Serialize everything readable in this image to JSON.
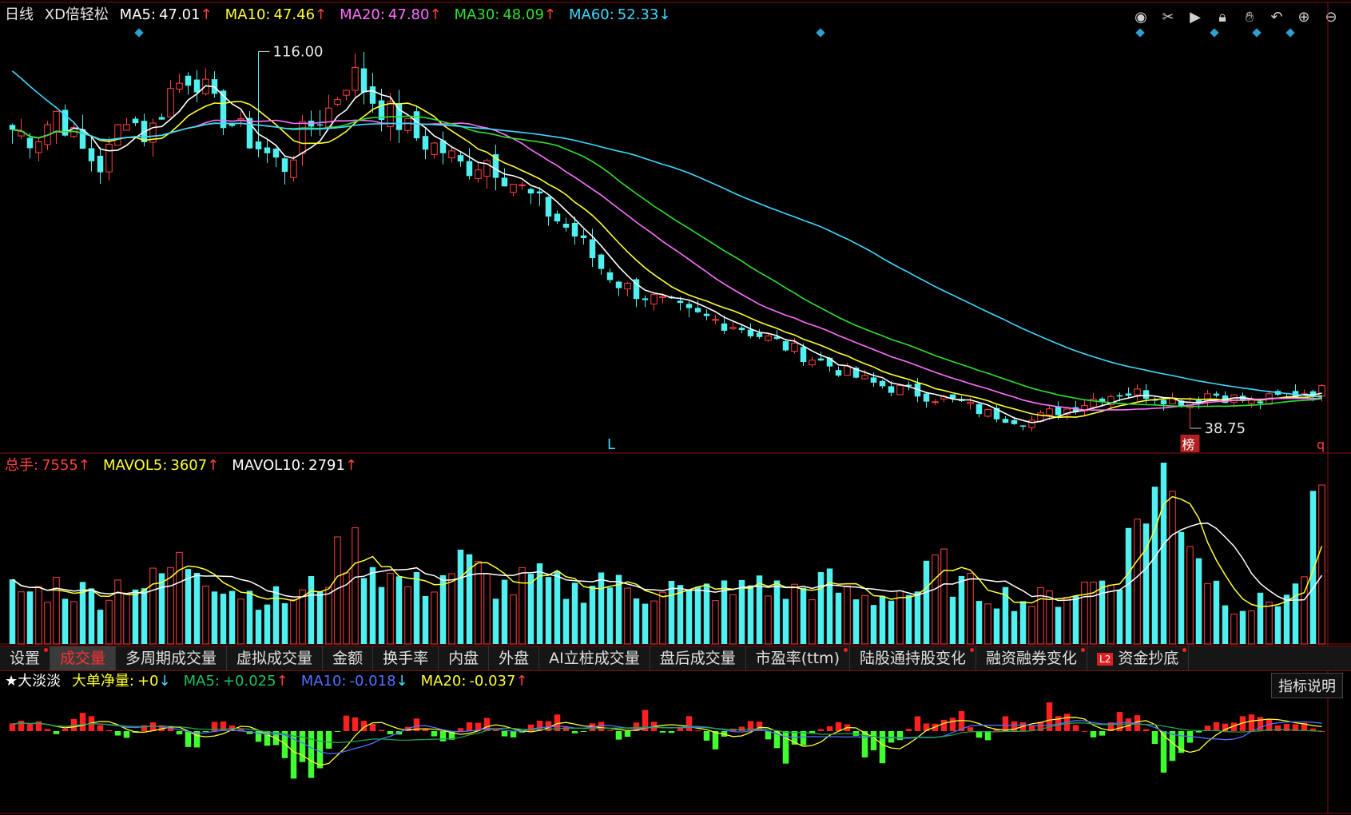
{
  "header": {
    "period": "日线",
    "stock": "XD倍轻松",
    "ma": [
      {
        "label": "MA5:",
        "value": "47.01",
        "arrow": "↑",
        "color": "#ffffff"
      },
      {
        "label": "MA10:",
        "value": "47.46",
        "arrow": "↑",
        "color": "#ffff30"
      },
      {
        "label": "MA20:",
        "value": "47.80",
        "arrow": "↑",
        "color": "#ff70ff"
      },
      {
        "label": "MA30:",
        "value": "48.09",
        "arrow": "↑",
        "color": "#30e030"
      },
      {
        "label": "MA60:",
        "value": "52.33",
        "arrow": "↓",
        "color": "#40d8ff"
      }
    ]
  },
  "toolbar_icons": [
    "eye-icon",
    "scissors-icon",
    "play-icon",
    "lock-icon",
    "hand-icon",
    "undo-icon",
    "zoom-in-icon",
    "zoom-out-icon"
  ],
  "price_panel": {
    "high_label": "116.00",
    "low_label": "38.75",
    "marker_L": "L",
    "marker_bang": "榜",
    "marker_q": "q"
  },
  "volume_panel": {
    "legend": [
      {
        "label": "总手:",
        "value": "7555",
        "arrow": "↑",
        "color": "#ff4040"
      },
      {
        "label": "MAVOL5:",
        "value": "3607",
        "arrow": "↑",
        "color": "#ffff30"
      },
      {
        "label": "MAVOL10:",
        "value": "2791",
        "arrow": "↑",
        "color": "#ffffff"
      }
    ]
  },
  "tabs": [
    {
      "label": "设置",
      "dot": true,
      "active": false
    },
    {
      "label": "成交量",
      "dot": false,
      "active": true
    },
    {
      "label": "多周期成交量",
      "dot": false,
      "active": false
    },
    {
      "label": "虚拟成交量",
      "dot": false,
      "active": false
    },
    {
      "label": "金额",
      "dot": false,
      "active": false
    },
    {
      "label": "换手率",
      "dot": false,
      "active": false
    },
    {
      "label": "内盘",
      "dot": false,
      "active": false
    },
    {
      "label": "外盘",
      "dot": false,
      "active": false
    },
    {
      "label": "AI立桩成交量",
      "dot": false,
      "active": false
    },
    {
      "label": "盘后成交量",
      "dot": false,
      "active": false
    },
    {
      "label": "市盈率(ttm)",
      "dot": true,
      "active": false
    },
    {
      "label": "陆股通持股变化",
      "dot": true,
      "active": false
    },
    {
      "label": "融资融券变化",
      "dot": true,
      "active": false
    },
    {
      "label": "资金抄底",
      "dot": true,
      "active": false,
      "badge": "L2"
    }
  ],
  "indicator_panel": {
    "title": "★大淡淡",
    "legend": [
      {
        "label": "大单净量:",
        "value": "+0",
        "arrow": "↓",
        "color": "#ffff30"
      },
      {
        "label": "MA5:",
        "value": "+0.025",
        "arrow": "↑",
        "color": "#20c060"
      },
      {
        "label": "MA10:",
        "value": "-0.018",
        "arrow": "↓",
        "color": "#5070ff"
      },
      {
        "label": "MA20:",
        "value": "-0.037",
        "arrow": "↑",
        "color": "#ffff30"
      }
    ],
    "explain_button": "指标说明"
  },
  "colors": {
    "up": "#ff4040",
    "down": "#50f0f0",
    "ma5": "#ffffff",
    "ma10": "#ffff30",
    "ma20": "#ff70ff",
    "ma30": "#30e030",
    "ma60": "#40d8ff",
    "grid": "#8a1010"
  },
  "chart_data": {
    "type": "candlestick",
    "anchors": {
      "high": 116.0,
      "low": 38.75,
      "ma5": 47.01,
      "ma10": 47.46,
      "ma20": 47.8,
      "ma30": 48.09,
      "ma60": 52.33,
      "last_volume": 7555,
      "mavol5": 3607,
      "mavol10": 2791
    },
    "close_path": [
      100,
      98,
      104,
      96,
      92,
      104,
      98,
      108,
      112,
      104,
      100,
      96,
      92,
      100,
      104,
      112,
      106,
      102,
      98,
      96,
      92,
      94,
      90,
      86,
      82,
      78,
      72,
      68,
      66,
      64,
      62,
      61,
      60,
      58,
      56,
      54,
      52,
      50,
      48,
      47,
      46,
      45,
      44,
      42,
      41,
      40,
      42,
      43,
      45,
      46,
      46,
      45,
      44,
      46,
      45,
      44,
      45,
      46,
      47
    ],
    "volume_path": [
      2600,
      2400,
      2800,
      2500,
      2300,
      3100,
      2700,
      3600,
      4000,
      3200,
      2500,
      2300,
      2100,
      2400,
      3400,
      4800,
      3800,
      3000,
      2700,
      3200,
      3900,
      3000,
      2600,
      3100,
      2800,
      2500,
      3300,
      2600,
      2400,
      2900,
      2200,
      2700,
      2300,
      3200,
      2400,
      2600,
      3000,
      2300,
      2100,
      2600,
      2400,
      3900,
      2700,
      2500,
      2300,
      2000,
      2200,
      2600,
      2900,
      3400,
      6500,
      7800,
      5900,
      3200,
      2000,
      1800,
      2200,
      2600,
      7555
    ],
    "netflow_path": [
      0.1,
      0.2,
      -0.1,
      0.3,
      0.1,
      -0.2,
      0.2,
      0.1,
      -0.3,
      0.2,
      0.1,
      -0.2,
      -0.4,
      -0.9,
      -0.3,
      0.4,
      0.1,
      -0.1,
      0.2,
      -0.3,
      0.1,
      0.2,
      -0.2,
      0.1,
      0.3,
      -0.1,
      0.2,
      -0.2,
      0.3,
      -0.1,
      0.2,
      -0.3,
      0.1,
      0.2,
      -0.5,
      -0.2,
      0.1,
      0.2,
      -0.6,
      -0.3,
      0.2,
      0.1,
      0.3,
      -0.2,
      0.2,
      0.1,
      0.4,
      0.2,
      -0.2,
      0.3,
      0.2,
      -0.6,
      -0.2,
      0.1,
      0.2,
      0.3,
      0.1,
      0.2,
      0.0
    ]
  }
}
